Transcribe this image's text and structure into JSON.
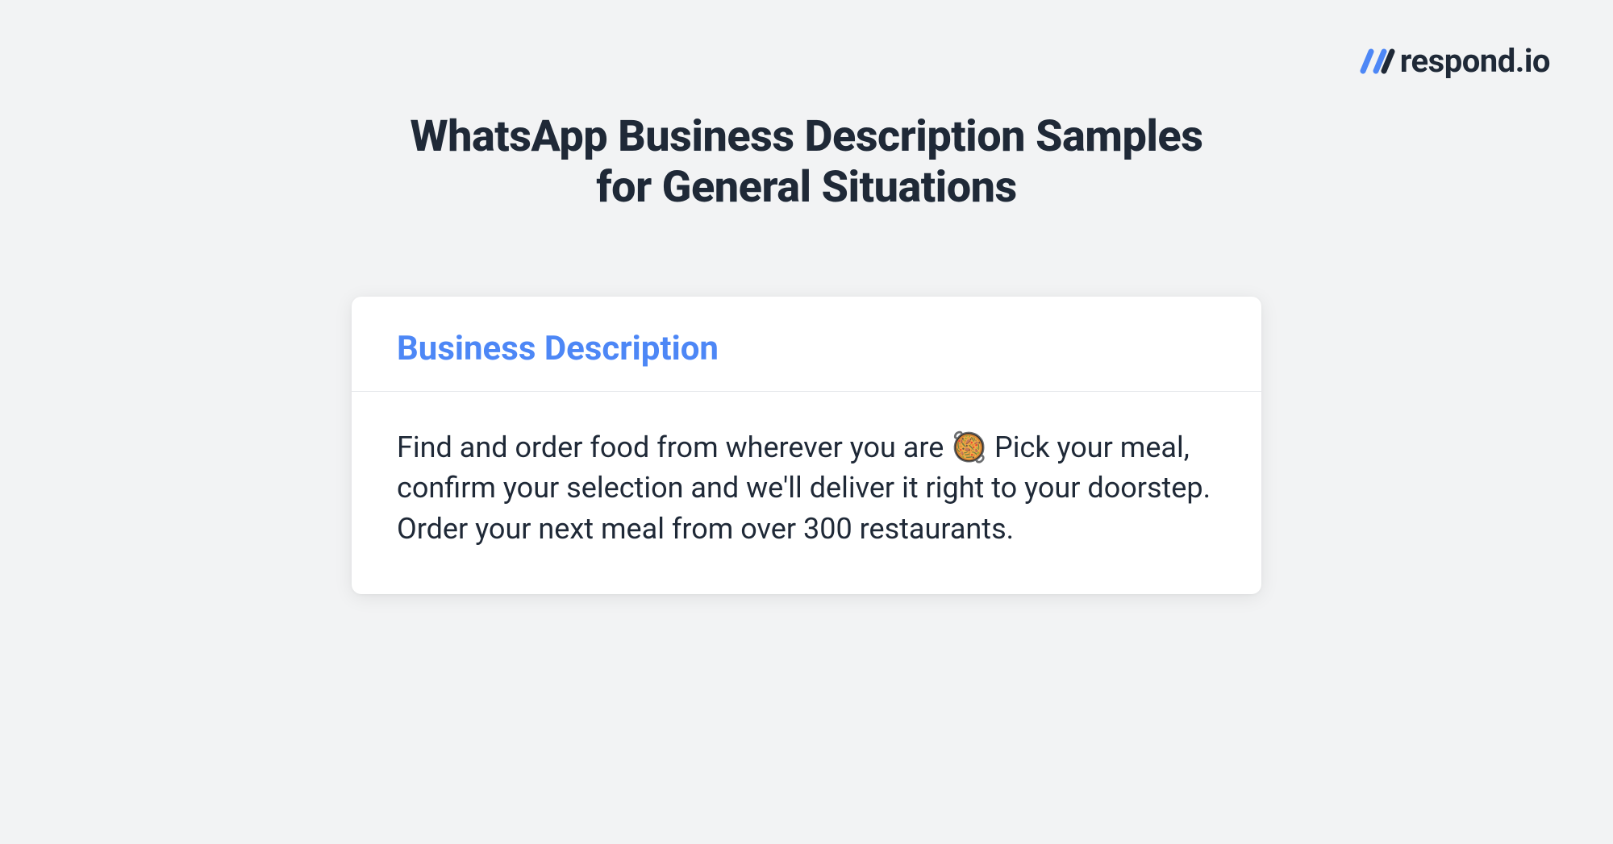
{
  "logo": {
    "text": "respond.io"
  },
  "page": {
    "title": "WhatsApp Business Description Samples for General Situations"
  },
  "card": {
    "title": "Business Description",
    "description": "Find and order food from wherever you are 🥘 Pick your meal, confirm your selection and we'll deliver it right to your doorstep. Order your next meal from over 300 restaurants."
  }
}
